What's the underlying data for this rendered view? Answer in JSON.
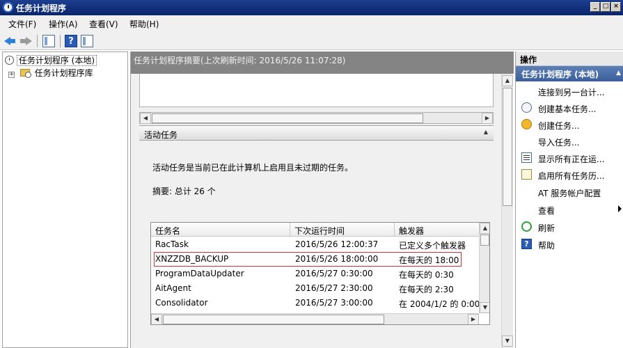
{
  "window": {
    "title": "任务计划程序",
    "controls": [
      "_",
      "□",
      "×"
    ]
  },
  "menu": {
    "items": [
      "文件(F)",
      "操作(A)",
      "查看(V)",
      "帮助(H)"
    ]
  },
  "tree": {
    "root": "任务计划程序 (本地)",
    "child": "任务计划程序库",
    "expander": "+"
  },
  "summary": {
    "header": "任务计划程序摘要(上次刷新时间: 2016/5/26 11:07:28)"
  },
  "active_tasks": {
    "title": "活动任务",
    "description": "活动任务是当前已在此计算机上启用且未过期的任务。",
    "summary": "摘要: 总计 26 个",
    "columns": [
      "任务名",
      "下次运行时间",
      "触发器"
    ],
    "rows": [
      {
        "name": "RacTask",
        "next_run": "2016/5/26 12:00:37",
        "trigger": "已定义多个触发器"
      },
      {
        "name": "XNZZDB_BACKUP",
        "next_run": "2016/5/26 18:00:00",
        "trigger": "在每天的 18:00"
      },
      {
        "name": "ProgramDataUpdater",
        "next_run": "2016/5/27 0:30:00",
        "trigger": "在每天的 0:30"
      },
      {
        "name": "AitAgent",
        "next_run": "2016/5/27 2:30:00",
        "trigger": "在每天的 2:30"
      },
      {
        "name": "Consolidator",
        "next_run": "2016/5/27 3:00:00",
        "trigger": "在 2004/1/2 的 0:00"
      }
    ],
    "highlighted_row": 1
  },
  "actions": {
    "header": "操作",
    "group": "任务计划程序 (本地)",
    "items": [
      {
        "label": "连接到另一台计...",
        "icon": "none"
      },
      {
        "label": "创建基本任务...",
        "icon": "clock-icon"
      },
      {
        "label": "创建任务...",
        "icon": "task-star-icon"
      },
      {
        "label": "导入任务...",
        "icon": "none"
      },
      {
        "label": "显示所有正在运...",
        "icon": "list-icon"
      },
      {
        "label": "启用所有任务历...",
        "icon": "history-icon"
      },
      {
        "label": "AT 服务帐户配置",
        "icon": "none"
      },
      {
        "label": "查看",
        "icon": "none"
      },
      {
        "label": "刷新",
        "icon": "refresh-icon"
      },
      {
        "label": "帮助",
        "icon": "help-icon"
      }
    ],
    "help_glyph": "?"
  },
  "toolbar": {
    "help_glyph": "?"
  },
  "glyphs": {
    "up": "▲",
    "down": "▼",
    "left": "◀",
    "right": "▶",
    "collapse": "▲"
  }
}
